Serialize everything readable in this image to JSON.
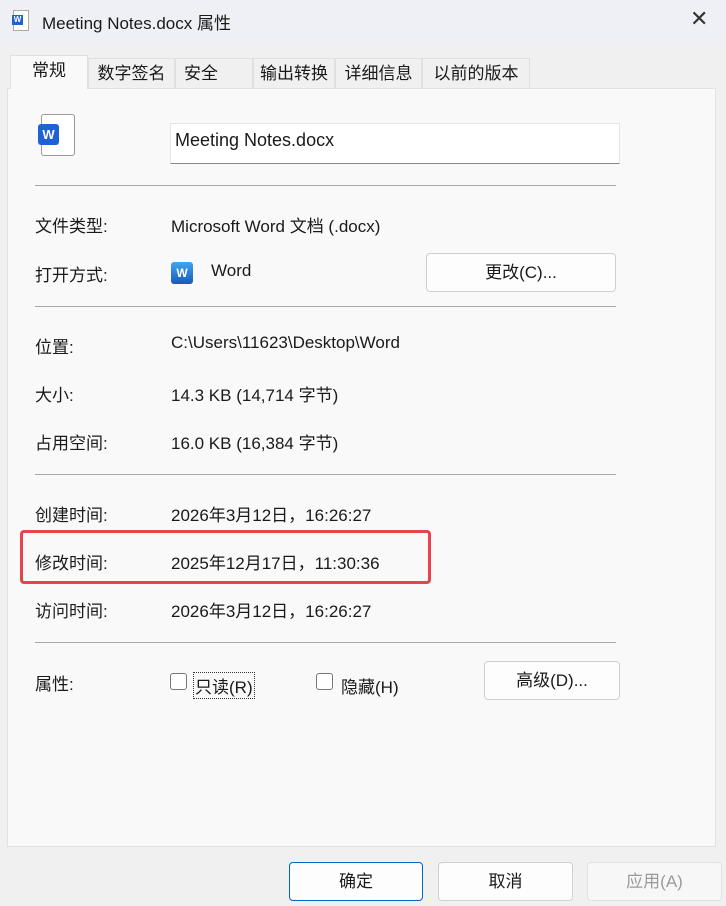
{
  "window": {
    "title": "Meeting Notes.docx 属性",
    "close": "✕"
  },
  "tabs": [
    "常规",
    "数字签名",
    "安全",
    "输出转换",
    "详细信息",
    "以前的版本"
  ],
  "file_name": "Meeting Notes.docx",
  "rows": {
    "type": {
      "label": "文件类型:",
      "value": "Microsoft Word 文档 (.docx)"
    },
    "opens_with": {
      "label": "打开方式:",
      "value": "Word",
      "button": "更改(C)..."
    },
    "location": {
      "label": "位置:",
      "value": "C:\\Users\\11623\\Desktop\\Word"
    },
    "size": {
      "label": "大小:",
      "value": "14.3 KB (14,714 字节)"
    },
    "size_on_disk": {
      "label": "占用空间:",
      "value": "16.0 KB (16,384 字节)"
    },
    "created": {
      "label": "创建时间:",
      "value": "2026年3月12日，16:26:27"
    },
    "modified": {
      "label": "修改时间:",
      "value": "2025年12月17日，11:30:36"
    },
    "accessed": {
      "label": "访问时间:",
      "value": "2026年3月12日，16:26:27"
    },
    "attributes": {
      "label": "属性:",
      "readonly": "只读(R)",
      "hidden": "隐藏(H)",
      "advanced": "高级(D)..."
    }
  },
  "buttons": {
    "ok": "确定",
    "cancel": "取消",
    "apply": "应用(A)"
  },
  "colors": {
    "highlight": "#e8434a",
    "word_blue": "#1e62d6"
  }
}
